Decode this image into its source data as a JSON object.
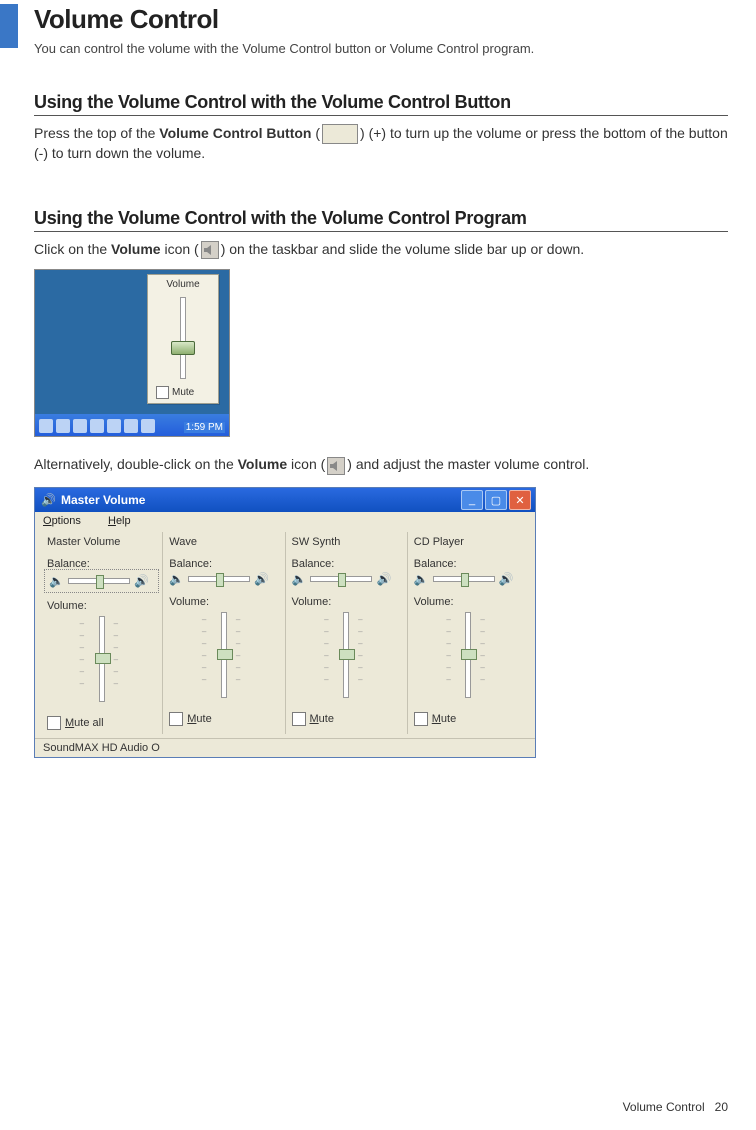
{
  "page": {
    "title": "Volume Control",
    "intro": "You can control the volume with the Volume Control button or Volume Control program.",
    "footer_label": "Volume Control",
    "footer_page": "20"
  },
  "section1": {
    "heading": "Using the Volume Control with the Volume Control Button",
    "p1a": "Press the top of the ",
    "p1_bold": "Volume Control Button",
    "p1b": " (",
    "p1c": ") (+) to turn up the volume or press the bottom of the button (-) to turn down the volume."
  },
  "section2": {
    "heading": "Using the Volume Control with the Volume Control Program",
    "p1a": "Click on the ",
    "p1_bold": "Volume",
    "p1b": " icon (",
    "p1c": ") on the taskbar and slide the volume slide bar up or down.",
    "p2a": "Alternatively, double-click on the ",
    "p2_bold": "Volume",
    "p2b": " icon (",
    "p2c": ") and adjust the master volume control."
  },
  "shot1": {
    "popup_label": "Volume",
    "mute_label": "Mute",
    "clock": "1:59 PM"
  },
  "shot2": {
    "title": "Master Volume",
    "menu_options": "Options",
    "menu_help": "Help",
    "balance_label": "Balance:",
    "volume_label": "Volume:",
    "mute_all": "Mute all",
    "mute": "Mute",
    "status": "SoundMAX HD Audio O",
    "cols": [
      {
        "name": "Master Volume"
      },
      {
        "name": "Wave"
      },
      {
        "name": "SW Synth"
      },
      {
        "name": "CD Player"
      }
    ]
  }
}
